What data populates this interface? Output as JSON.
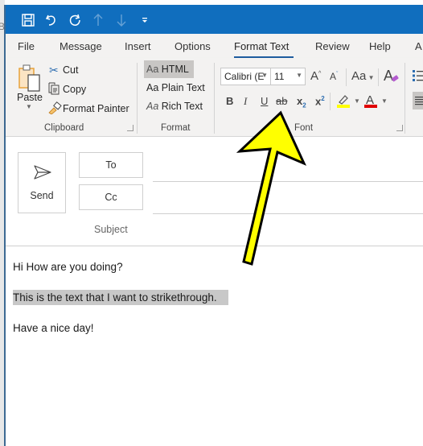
{
  "quick_access": {
    "icons": [
      "save-icon",
      "undo-icon",
      "redo-icon",
      "up-arrow-icon",
      "down-arrow-icon",
      "customize-toolbar-icon"
    ]
  },
  "tabs": [
    {
      "label": "File",
      "active": false
    },
    {
      "label": "Message",
      "active": false
    },
    {
      "label": "Insert",
      "active": false
    },
    {
      "label": "Options",
      "active": false
    },
    {
      "label": "Format Text",
      "active": true
    },
    {
      "label": "Review",
      "active": false
    },
    {
      "label": "Help",
      "active": false
    },
    {
      "label": "A",
      "active": false
    }
  ],
  "ribbon": {
    "clipboard": {
      "label": "Clipboard",
      "paste": "Paste",
      "cut": "Cut",
      "copy": "Copy",
      "format_painter": "Format Painter"
    },
    "format": {
      "label": "Format",
      "options": [
        {
          "prefix": "Aa",
          "label": "HTML",
          "selected": true
        },
        {
          "prefix": "Aa",
          "label": "Plain Text",
          "selected": false
        },
        {
          "prefix": "Aa",
          "label": "Rich Text",
          "selected": false
        }
      ]
    },
    "font": {
      "label": "Font",
      "font_name": "Calibri (E",
      "font_size": "11",
      "change_case": "Aa",
      "bold": "B",
      "italic": "I",
      "underline": "U",
      "strikethrough": "ab",
      "subscript": "x",
      "superscript": "x",
      "highlight_color": "#ffff00",
      "font_color": "#e00000"
    }
  },
  "compose": {
    "send_label": "Send",
    "to_label": "To",
    "cc_label": "Cc",
    "subject_label": "Subject",
    "to_value": "",
    "cc_value": "",
    "subject_value": ""
  },
  "body": {
    "lines": [
      "Hi How are you doing?",
      "This is the text that I want to strikethrough.",
      "Have a nice day!"
    ],
    "selected_line_index": 1
  },
  "annotation": {
    "type": "arrow",
    "color": "#ffff00",
    "points_to": "strikethrough-button"
  }
}
